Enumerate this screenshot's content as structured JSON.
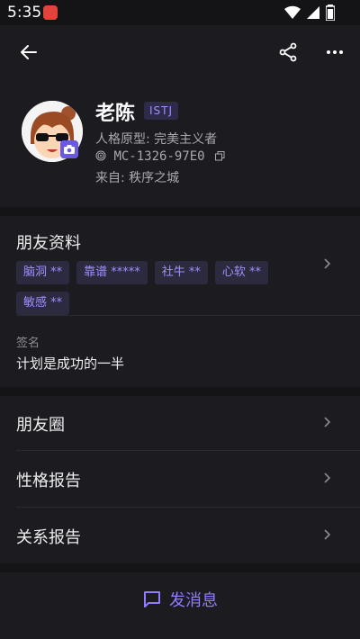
{
  "status": {
    "time": "5:35"
  },
  "profile": {
    "name": "老陈",
    "type_badge": "ISTJ",
    "archetype": "人格原型: 完美主义者",
    "id": "MC-1326-97E0",
    "from": "来自: 秩序之城"
  },
  "friend_info": {
    "title": "朋友资料",
    "tags": [
      "脑洞 **",
      "靠谱 *****",
      "社牛 **",
      "心软 **",
      "敏感 **"
    ]
  },
  "signature": {
    "label": "签名",
    "text": "计划是成功的一半"
  },
  "menu": [
    {
      "label": "朋友圈"
    },
    {
      "label": "性格报告"
    },
    {
      "label": "关系报告"
    }
  ],
  "action": {
    "send_label": "发消息"
  },
  "colors": {
    "accent": "#8f7cff",
    "background": "#1c1c20",
    "divider": "#141416"
  }
}
